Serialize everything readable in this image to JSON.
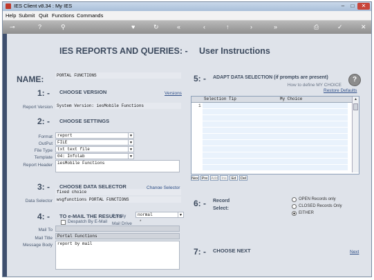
{
  "window": {
    "title": "IES Client v8.34 : My IES",
    "buttons": [
      "–",
      "□",
      "✕"
    ]
  },
  "menu": [
    "Help",
    "Submit",
    "Quit",
    "Functions",
    "Commands"
  ],
  "toolbar_icons": [
    "key-icon",
    "help-icon",
    "search-icon",
    "heart-icon",
    "refresh-icon",
    "rewind-icon",
    "back-icon",
    "up-icon",
    "forward-icon",
    "fastforward-icon",
    "print-icon",
    "check-icon",
    "close-icon"
  ],
  "header": {
    "title": "IES REPORTS AND QUERIES: -",
    "subtitle": "User Instructions"
  },
  "name": {
    "label": "NAME:",
    "value": "PORTAL FUNCTIONS"
  },
  "s1": {
    "num": "1: -",
    "title": "CHOOSE VERSION",
    "link": "Versions",
    "report_version_label": "Report Version",
    "report_version_value": "System Version: iesMobile Functions"
  },
  "s2": {
    "num": "2: -",
    "title": "CHOOSE SETTINGS",
    "format_label": "Format",
    "format_value": "report",
    "output_label": "OutPut",
    "output_value": "FILE",
    "filetype_label": "File Type",
    "filetype_value": "txt text file",
    "template_label": "Template",
    "template_value": "04: Infolab",
    "header_label": "Report Header",
    "header_value": "iesMobile Functions"
  },
  "s3": {
    "num": "3: -",
    "title": "CHOOSE DATA SELECTOR",
    "link": "Change Selector",
    "data_selector_label": "Data Selector",
    "line1": "fixed choice",
    "line2": "wsgfunctions PORTAL FUNCTIONS"
  },
  "s4": {
    "num": "4: -",
    "title": "TO e-MAIL THE RESULTS",
    "priority_label": "Priority",
    "priority_value": "normal",
    "despatch_label": "Despatch By E-Mail",
    "mail_drive_label": "Mail Drive",
    "mail_drive_value": "*",
    "mail_to_label": "Mail To",
    "mail_title_label": "Mail Title",
    "mail_title_value": "Portal Functions",
    "mail_body_label": "Message Body",
    "mail_body_value": "report by mail"
  },
  "s5": {
    "num": "5: -",
    "title": "ADAPT DATA SELECTION (if prompts are present)",
    "help_link": "How to define MY CHOICE",
    "restore_link": "Restore Defaults",
    "col_tip": "Selection Tip",
    "col_choice": "My Choice",
    "row1": "1",
    "nav": [
      "Nex",
      "Pre",
      "Add",
      "Ins",
      "Ed",
      "Del"
    ]
  },
  "s6": {
    "num": "6: -",
    "title": "Record",
    "select_label": "Select:",
    "opt1": "OPEN Records only",
    "opt2": "CLOSED Records Only",
    "opt3": "EITHER"
  },
  "s7": {
    "num": "7: -",
    "title": "CHOOSE NEXT",
    "next_link": "Next"
  },
  "colors": {
    "accent_text": "#3c4a5e",
    "toolbar": "#9e9e9e",
    "panel": "#dfe3ea",
    "link": "#2f4f88"
  }
}
